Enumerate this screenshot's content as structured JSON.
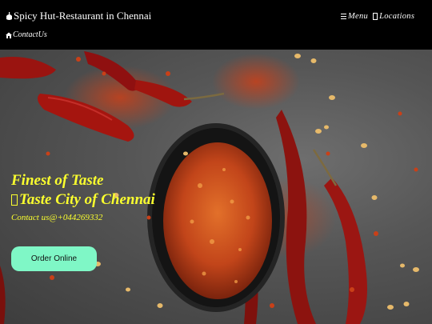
{
  "header": {
    "brand": "Spicy Hut-Restaurant in Chennai",
    "brand_icon": "food-icon",
    "nav": [
      {
        "label": "Menu",
        "icon": "hamburger-icon"
      },
      {
        "label": "Locations",
        "icon": "location-icon"
      }
    ],
    "contact": {
      "label": "ContactUs",
      "icon": "home-icon"
    }
  },
  "hero": {
    "line1": "Finest of Taste",
    "line2": "Taste City of Chennai",
    "phone": "Contact us@+044269332",
    "order_button": "Order Online",
    "accent_color": "#fbff2e",
    "button_color": "#7ff7c6",
    "background": "chili flakes bowl on grey stone"
  }
}
